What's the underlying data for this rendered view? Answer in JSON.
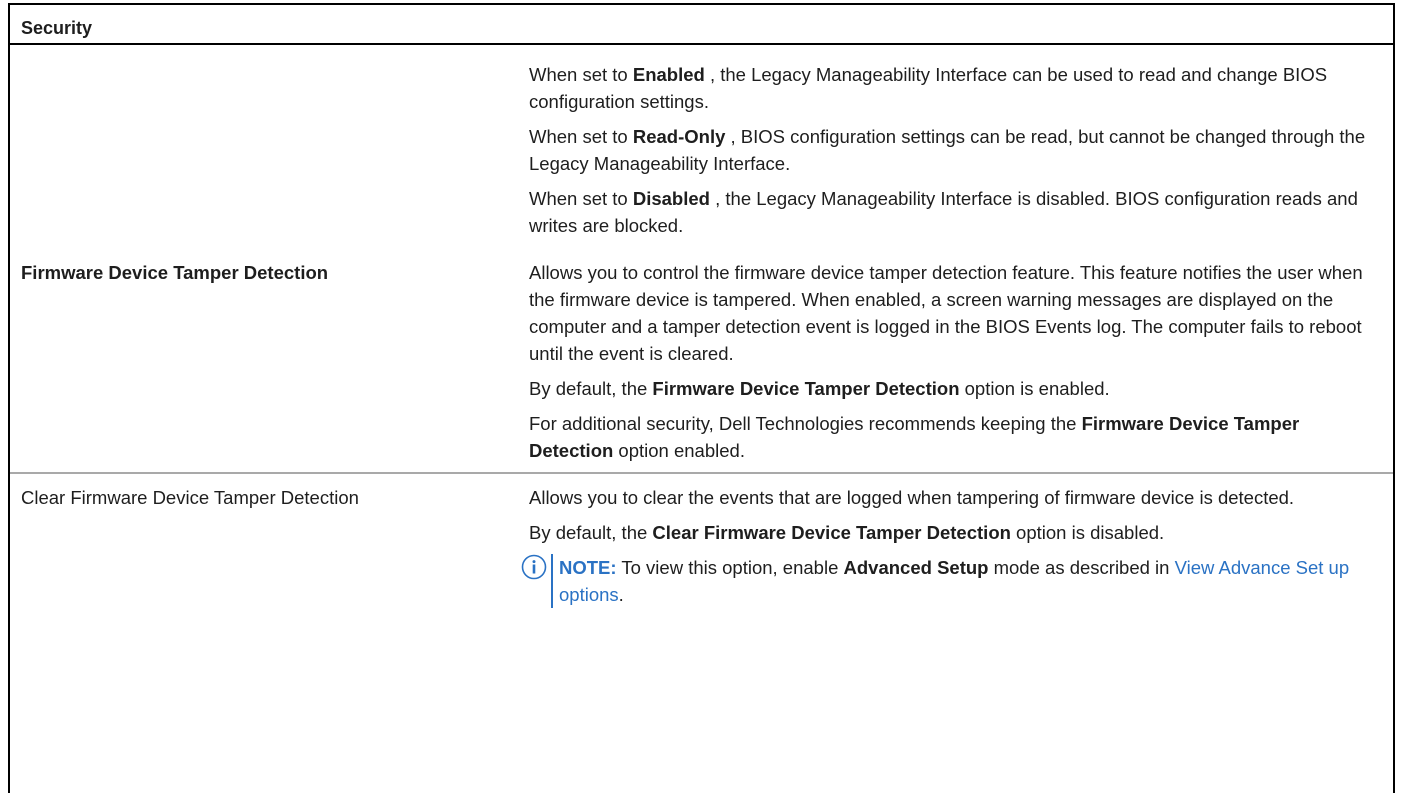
{
  "header": {
    "title": "Security"
  },
  "row0": {
    "p1": {
      "pre": "When set to ",
      "bold": "Enabled",
      "post": " , the Legacy Manageability Interface can be used to read and change BIOS configuration settings."
    },
    "p2": {
      "pre": "When set to ",
      "bold": "Read-Only",
      "post": " , BIOS configuration settings can be read, but cannot be changed through the Legacy Manageability Interface."
    },
    "p3": {
      "pre": "When set to ",
      "bold": "Disabled",
      "post": " , the Legacy Manageability Interface is disabled. BIOS configuration reads and writes are blocked."
    }
  },
  "row1": {
    "label": "Firmware Device Tamper Detection",
    "p1": "Allows you to control the firmware device tamper detection feature. This feature notifies the user when the firmware device is tampered. When enabled, a screen warning messages are displayed on the computer and a tamper detection event is logged in the BIOS Events log. The computer fails to reboot until the event is cleared.",
    "p2": {
      "pre": "By default, the ",
      "bold": "Firmware Device Tamper Detection",
      "post": " option is enabled."
    },
    "p3": {
      "pre": "For additional security, Dell Technologies recommends keeping the ",
      "bold": "Firmware Device Tamper Detection",
      "post": " option enabled."
    }
  },
  "row2": {
    "label": "Clear Firmware Device Tamper Detection",
    "p1": "Allows you to clear the events that are logged when tampering of firmware device is detected.",
    "p2": {
      "pre": "By default, the ",
      "bold": "Clear Firmware Device Tamper Detection",
      "post": " option is disabled."
    },
    "note": {
      "label": "NOTE:",
      "pre": " To view this option, enable ",
      "bold": "Advanced Setup",
      "post": " mode as described in ",
      "link": "View Advance Set up options",
      "end": "."
    }
  },
  "colors": {
    "accent": "#2a72c4",
    "text": "#1e1e1e",
    "divider": "#a9a9a9"
  },
  "icons": {
    "note": "info-circle-icon"
  }
}
